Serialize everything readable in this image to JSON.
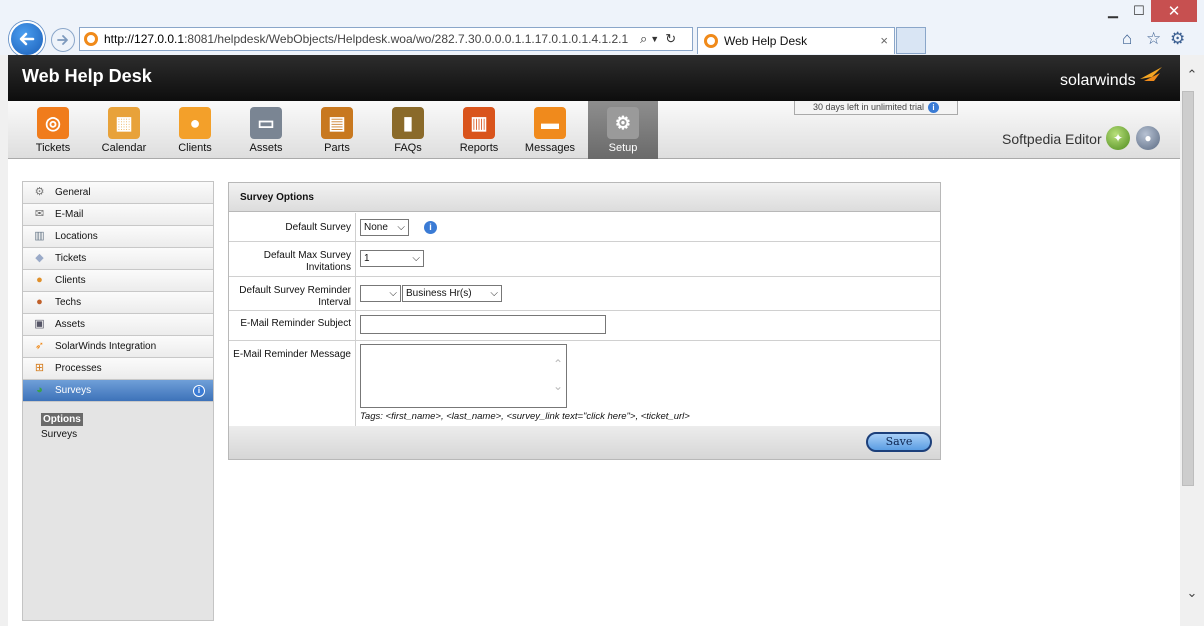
{
  "browser": {
    "url_host": "http://127.0.0.1",
    "url_rest": ":8081/helpdesk/WebObjects/Helpdesk.woa/wo/282.7.30.0.0.0.1.1.17.0.1.0.1.4.1.2.1",
    "tab_title": "Web Help Desk",
    "tab_close": "×"
  },
  "header": {
    "app_title": "Web Help Desk",
    "brand": "solarwinds"
  },
  "toolbar": {
    "items": [
      {
        "label": "Tickets",
        "icon": "lifebuoy-icon",
        "color": "#f07c1c"
      },
      {
        "label": "Calendar",
        "icon": "calendar-icon",
        "color": "#e8a23a"
      },
      {
        "label": "Clients",
        "icon": "person-icon",
        "color": "#f3a02a"
      },
      {
        "label": "Assets",
        "icon": "monitor-icon",
        "color": "#7a8593"
      },
      {
        "label": "Parts",
        "icon": "toolbox-icon",
        "color": "#c8781f"
      },
      {
        "label": "FAQs",
        "icon": "book-icon",
        "color": "#8a6a2a"
      },
      {
        "label": "Reports",
        "icon": "bar-report-icon",
        "color": "#d9541c"
      },
      {
        "label": "Messages",
        "icon": "messages-icon",
        "color": "#f08a1c"
      },
      {
        "label": "Setup",
        "icon": "gear-icon",
        "color": "#9a9a9a"
      }
    ],
    "active": "Setup",
    "trial_notice": "30 days left in unlimited trial",
    "user_name": "Softpedia Editor"
  },
  "sidebar": {
    "items": [
      {
        "label": "General",
        "icon": "gear-icon"
      },
      {
        "label": "E-Mail",
        "icon": "envelope-icon"
      },
      {
        "label": "Locations",
        "icon": "building-icon"
      },
      {
        "label": "Tickets",
        "icon": "tag-icon"
      },
      {
        "label": "Clients",
        "icon": "clients-icon"
      },
      {
        "label": "Techs",
        "icon": "tech-icon"
      },
      {
        "label": "Assets",
        "icon": "computer-icon"
      },
      {
        "label": "SolarWinds Integration",
        "icon": "solarwinds-icon"
      },
      {
        "label": "Processes",
        "icon": "process-icon"
      },
      {
        "label": "Surveys",
        "icon": "pie-icon"
      }
    ],
    "selected": "Surveys",
    "sub_items": [
      {
        "label": "Options",
        "active": true
      },
      {
        "label": "Surveys",
        "active": false
      }
    ]
  },
  "form": {
    "title": "Survey Options",
    "default_survey": {
      "label": "Default Survey",
      "value": "None"
    },
    "default_max_invitations": {
      "label": "Default Max Survey Invitations",
      "value": "1"
    },
    "reminder_interval": {
      "label": "Default Survey Reminder Interval",
      "value": "",
      "unit": "Business Hr(s)"
    },
    "reminder_subject": {
      "label": "E-Mail Reminder Subject",
      "value": ""
    },
    "reminder_message": {
      "label": "E-Mail Reminder Message",
      "value": ""
    },
    "tags_text": "Tags: <first_name>, <last_name>, <survey_link text=\"click here\">, <ticket_url>",
    "save_label": "Save"
  }
}
